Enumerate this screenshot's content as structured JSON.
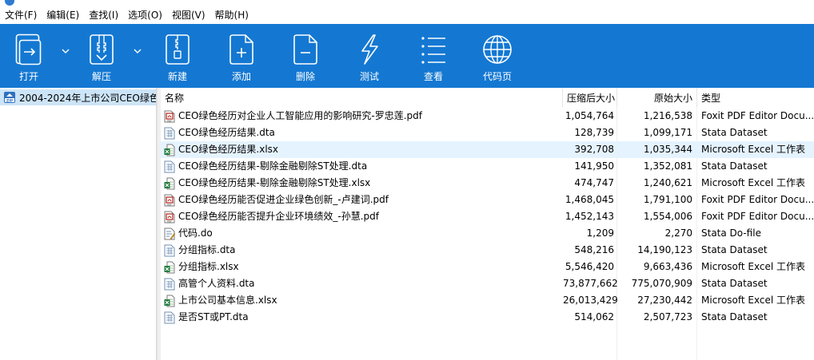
{
  "menu": [
    "文件(F)",
    "编辑(E)",
    "查找(I)",
    "选项(O)",
    "视图(V)",
    "帮助(H)"
  ],
  "toolbar": [
    {
      "label": "打开",
      "icon": "open-icon"
    },
    {
      "label": "解压",
      "icon": "extract-icon"
    },
    {
      "label": "新建",
      "icon": "new-archive-icon"
    },
    {
      "label": "添加",
      "icon": "add-icon"
    },
    {
      "label": "删除",
      "icon": "delete-icon"
    },
    {
      "label": "测试",
      "icon": "test-icon"
    },
    {
      "label": "查看",
      "icon": "view-icon"
    },
    {
      "label": "代码页",
      "icon": "codepage-icon"
    }
  ],
  "tree": {
    "label": "2004-2024年上市公司CEO绿色"
  },
  "columns": {
    "name": "名称",
    "csize": "压缩后大小",
    "osize": "原始大小",
    "type": "类型"
  },
  "files": [
    {
      "name": "CEO绿色经历对企业人工智能应用的影响研究-罗忠莲.pdf",
      "csize": "1,054,764",
      "osize": "1,216,538",
      "type": "Foxit PDF Editor Docu...",
      "kind": "pdf"
    },
    {
      "name": "CEO绿色经历结果.dta",
      "csize": "128,739",
      "osize": "1,099,171",
      "type": "Stata Dataset",
      "kind": "dta"
    },
    {
      "name": "CEO绿色经历结果.xlsx",
      "csize": "392,708",
      "osize": "1,035,344",
      "type": "Microsoft Excel 工作表",
      "kind": "xlsx"
    },
    {
      "name": "CEO绿色经历结果-剔除金融剔除ST处理.dta",
      "csize": "141,950",
      "osize": "1,352,081",
      "type": "Stata Dataset",
      "kind": "dta"
    },
    {
      "name": "CEO绿色经历结果-剔除金融剔除ST处理.xlsx",
      "csize": "474,747",
      "osize": "1,240,621",
      "type": "Microsoft Excel 工作表",
      "kind": "xlsx"
    },
    {
      "name": "CEO绿色经历能否促进企业绿色创新_-卢建词.pdf",
      "csize": "1,468,045",
      "osize": "1,791,100",
      "type": "Foxit PDF Editor Docu...",
      "kind": "pdf"
    },
    {
      "name": "CEO绿色经历能否提升企业环境绩效_-孙慧.pdf",
      "csize": "1,452,143",
      "osize": "1,554,006",
      "type": "Foxit PDF Editor Docu...",
      "kind": "pdf"
    },
    {
      "name": "代码.do",
      "csize": "1,209",
      "osize": "2,270",
      "type": "Stata Do-file",
      "kind": "do"
    },
    {
      "name": "分组指标.dta",
      "csize": "548,216",
      "osize": "14,190,123",
      "type": "Stata Dataset",
      "kind": "dta"
    },
    {
      "name": "分组指标.xlsx",
      "csize": "5,546,420",
      "osize": "9,663,436",
      "type": "Microsoft Excel 工作表",
      "kind": "xlsx"
    },
    {
      "name": "高管个人资料.dta",
      "csize": "73,877,662",
      "osize": "775,070,909",
      "type": "Stata Dataset",
      "kind": "dta"
    },
    {
      "name": "上市公司基本信息.xlsx",
      "csize": "26,013,429",
      "osize": "27,230,442",
      "type": "Microsoft Excel 工作表",
      "kind": "xlsx"
    },
    {
      "name": "是否ST或PT.dta",
      "csize": "514,062",
      "osize": "2,507,723",
      "type": "Stata Dataset",
      "kind": "dta"
    }
  ],
  "selected_index": 2,
  "colors": {
    "toolbar": "#1478d2",
    "selection": "#e5f3ff",
    "tree_selection": "#cce4f7"
  }
}
